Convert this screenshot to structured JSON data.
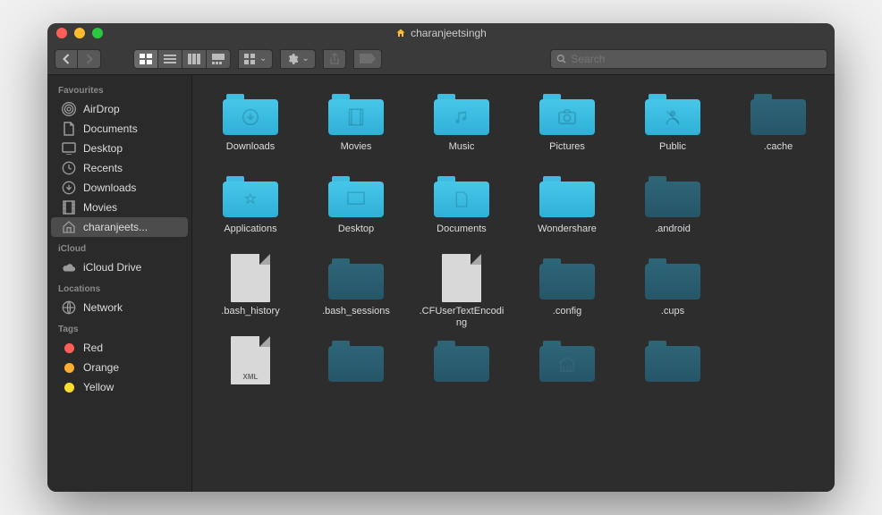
{
  "window_title": "charanjeetsingh",
  "search": {
    "placeholder": "Search"
  },
  "sidebar": {
    "sections": [
      {
        "header": "Favourites",
        "items": [
          {
            "icon": "airdrop",
            "label": "AirDrop"
          },
          {
            "icon": "doc",
            "label": "Documents"
          },
          {
            "icon": "desktop",
            "label": "Desktop"
          },
          {
            "icon": "recents",
            "label": "Recents"
          },
          {
            "icon": "download",
            "label": "Downloads"
          },
          {
            "icon": "movies",
            "label": "Movies"
          },
          {
            "icon": "home",
            "label": "charanjeets...",
            "selected": true
          }
        ]
      },
      {
        "header": "iCloud",
        "items": [
          {
            "icon": "cloud",
            "label": "iCloud Drive"
          }
        ]
      },
      {
        "header": "Locations",
        "items": [
          {
            "icon": "network",
            "label": "Network"
          }
        ]
      },
      {
        "header": "Tags",
        "items": [
          {
            "icon": "tag",
            "color": "#ff5f57",
            "label": "Red"
          },
          {
            "icon": "tag",
            "color": "#feae2e",
            "label": "Orange"
          },
          {
            "icon": "tag",
            "color": "#fedc2e",
            "label": "Yellow"
          }
        ]
      }
    ]
  },
  "items": [
    {
      "type": "folder",
      "style": "bright",
      "glyph": "download",
      "label": "Downloads"
    },
    {
      "type": "folder",
      "style": "bright",
      "glyph": "film",
      "label": "Movies"
    },
    {
      "type": "folder",
      "style": "bright",
      "glyph": "music",
      "label": "Music"
    },
    {
      "type": "folder",
      "style": "bright",
      "glyph": "camera",
      "label": "Pictures"
    },
    {
      "type": "folder",
      "style": "bright",
      "glyph": "public",
      "label": "Public"
    },
    {
      "type": "folder",
      "style": "dim",
      "glyph": "",
      "label": ".cache"
    },
    {
      "type": "folder",
      "style": "bright",
      "glyph": "apps",
      "label": "Applications"
    },
    {
      "type": "folder",
      "style": "bright",
      "glyph": "desktop",
      "label": "Desktop"
    },
    {
      "type": "folder",
      "style": "bright",
      "glyph": "doc",
      "label": "Documents"
    },
    {
      "type": "folder",
      "style": "bright",
      "glyph": "",
      "label": "Wondershare"
    },
    {
      "type": "folder",
      "style": "dim",
      "glyph": "",
      "label": ".android"
    },
    {
      "type": "blank",
      "label": ""
    },
    {
      "type": "doc",
      "label": ".bash_history"
    },
    {
      "type": "folder",
      "style": "dim",
      "glyph": "",
      "label": ".bash_sessions"
    },
    {
      "type": "doc",
      "label": ".CFUserTextEncoding"
    },
    {
      "type": "folder",
      "style": "dim",
      "glyph": "",
      "label": ".config"
    },
    {
      "type": "folder",
      "style": "dim",
      "glyph": "",
      "label": ".cups"
    },
    {
      "type": "blank",
      "label": ""
    },
    {
      "type": "doc",
      "xml": "XML",
      "label": ""
    },
    {
      "type": "folder",
      "style": "dim",
      "glyph": "",
      "label": ""
    },
    {
      "type": "folder",
      "style": "dim",
      "glyph": "",
      "label": ""
    },
    {
      "type": "folder",
      "style": "dim",
      "glyph": "library",
      "label": ""
    },
    {
      "type": "folder",
      "style": "dim",
      "glyph": "",
      "label": ""
    }
  ]
}
